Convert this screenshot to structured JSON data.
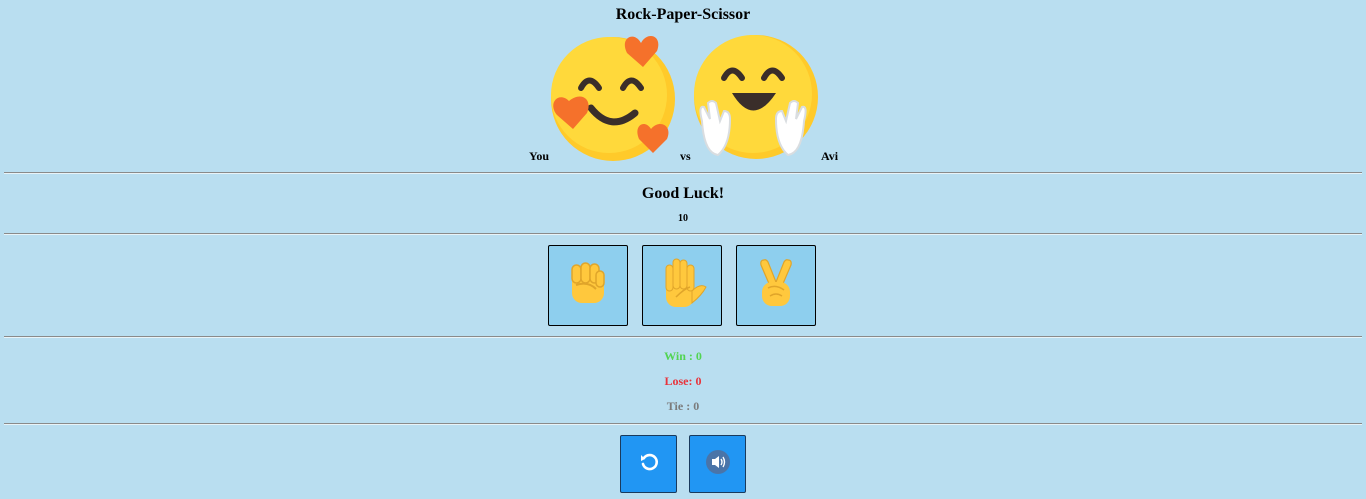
{
  "title": "Rock-Paper-Scissor",
  "players": {
    "you_label": "You",
    "vs_label": "vs",
    "opponent_label": "Avi",
    "you_icon": "smiling-face-with-hearts-icon",
    "opponent_icon": "hugging-face-icon"
  },
  "round": {
    "status": "Good Luck!",
    "timer": "10"
  },
  "choices": [
    {
      "name": "rock",
      "icon": "raised-fist-icon"
    },
    {
      "name": "paper",
      "icon": "raised-hand-icon"
    },
    {
      "name": "scissors",
      "icon": "victory-hand-icon"
    }
  ],
  "scores": {
    "win": "Win : 0",
    "lose": "Lose: 0",
    "tie": "Tie : 0"
  },
  "controls": {
    "reset_icon": "restart-icon",
    "sound_icon": "speaker-icon"
  },
  "colors": {
    "background": "#b9def0",
    "choice_bg": "#8ecfee",
    "control_bg": "#2196f3",
    "win": "#52d452",
    "lose": "#e8333b",
    "tie": "#7b7b7b"
  }
}
